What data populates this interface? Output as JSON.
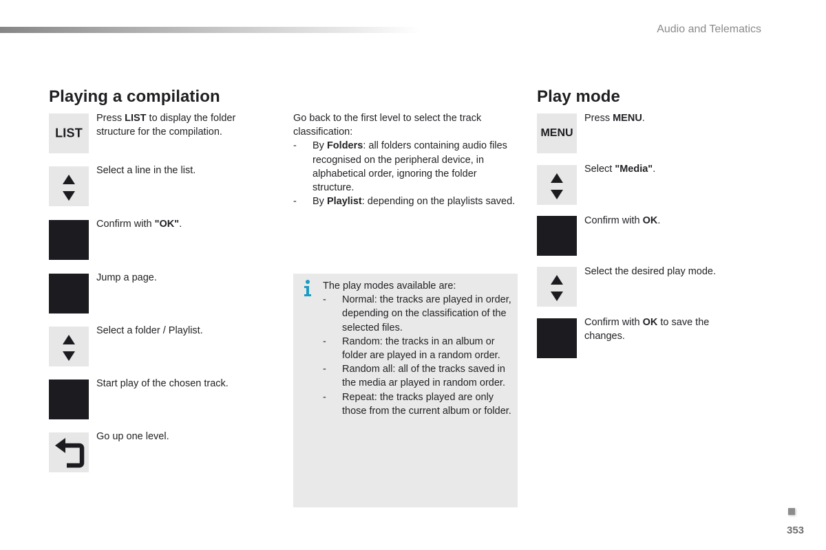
{
  "header": {
    "section_label": "Audio and Telematics"
  },
  "left_section": {
    "title": "Playing a compilation",
    "steps": [
      {
        "key": "LIST",
        "key_type": "label-key",
        "icon": "list-key-icon",
        "text_pre": "Press ",
        "text_bold": "LIST",
        "text_post": " to display the folder structure for the compilation."
      },
      {
        "key": "",
        "key_type": "arrows",
        "icon": "up-down-arrows-icon",
        "text_pre": "Select a line in the list.",
        "text_bold": "",
        "text_post": ""
      },
      {
        "key": "",
        "key_type": "dark",
        "icon": "ok-button-icon",
        "text_pre": "Confirm with ",
        "text_bold": "\"OK\"",
        "text_post": "."
      },
      {
        "key": "",
        "key_type": "dark",
        "icon": "page-jump-icon",
        "text_pre": "Jump a page.",
        "text_bold": "",
        "text_post": ""
      },
      {
        "key": "",
        "key_type": "arrows",
        "icon": "up-down-arrows-icon",
        "text_pre": "Select a folder / Playlist.",
        "text_bold": "",
        "text_post": ""
      },
      {
        "key": "",
        "key_type": "dark",
        "icon": "play-button-icon",
        "text_pre": "Start play of the chosen track.",
        "text_bold": "",
        "text_post": ""
      },
      {
        "key": "",
        "key_type": "back",
        "icon": "back-arrow-icon",
        "text_pre": "Go up one level.",
        "text_bold": "",
        "text_post": ""
      }
    ]
  },
  "middle_column": {
    "intro": "Go back to the first level to select the track classification:",
    "items": [
      {
        "dash": "-",
        "lead": "By ",
        "bold": "Folders",
        "rest": ": all folders containing audio files recognised on the peripheral device, in alphabetical order, ignoring the folder structure."
      },
      {
        "dash": "-",
        "lead": "By ",
        "bold": "Playlist",
        "rest": ": depending on the playlists saved."
      }
    ]
  },
  "info_box": {
    "icon": "info-icon",
    "icon_color": "#1a9cc2",
    "intro": "The play modes available are:",
    "items": [
      {
        "dash": "-",
        "text": "Normal: the tracks are played in order, depending on the classification of the selected files."
      },
      {
        "dash": "-",
        "text": "Random: the tracks in an album or folder are played in a random order."
      },
      {
        "dash": "-",
        "text": "Random all: all of the tracks saved in the media ar played in random order."
      },
      {
        "dash": "-",
        "text": "Repeat: the tracks played are only those from the current album or folder."
      }
    ]
  },
  "right_section": {
    "title": "Play mode",
    "steps": [
      {
        "key": "MENU",
        "key_type": "label-key",
        "icon": "menu-key-icon",
        "text_pre": "Press ",
        "text_bold": "MENU",
        "text_post": "."
      },
      {
        "key": "",
        "key_type": "arrows",
        "icon": "up-down-arrows-icon",
        "text_pre": "Select ",
        "text_bold": "\"Media\"",
        "text_post": "."
      },
      {
        "key": "",
        "key_type": "dark",
        "icon": "ok-button-icon",
        "text_pre": "Confirm with ",
        "text_bold": "OK",
        "text_post": "."
      },
      {
        "key": "",
        "key_type": "arrows",
        "icon": "up-down-arrows-icon",
        "text_pre": "Select the desired play mode.",
        "text_bold": "",
        "text_post": ""
      },
      {
        "key": "",
        "key_type": "dark",
        "icon": "ok-button-icon",
        "text_pre": "Confirm with ",
        "text_bold": "OK",
        "text_post": " to save the changes."
      }
    ]
  },
  "footer": {
    "page_number": "353"
  }
}
